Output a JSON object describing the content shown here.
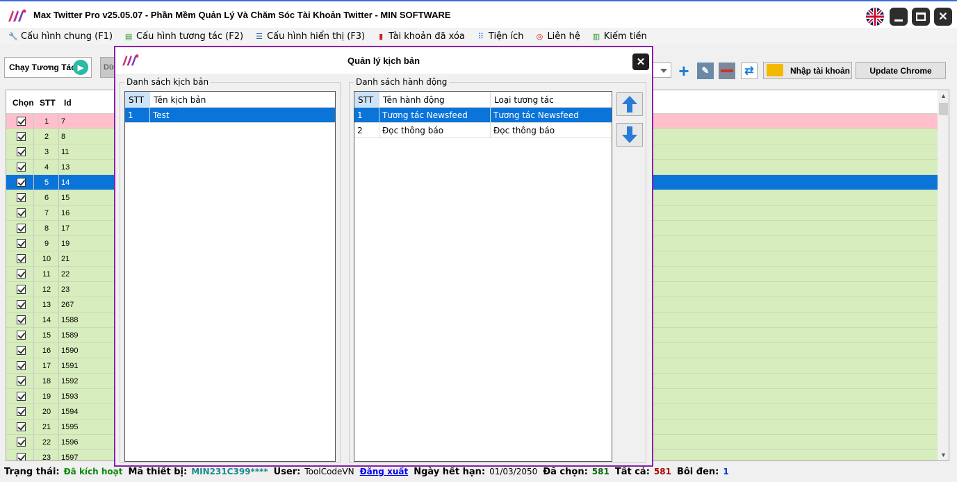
{
  "window": {
    "title": "Max Twitter Pro v25.05.07 - Phần Mềm Quản Lý Và Chăm Sóc Tài Khoản Twitter - MIN SOFTWARE",
    "language_icon": "uk-flag-icon"
  },
  "menu": {
    "items": [
      {
        "label": "Cấu hình chung (F1)",
        "icon": "wrench-icon"
      },
      {
        "label": "Cấu hình tương tác (F2)",
        "icon": "chat-icon"
      },
      {
        "label": "Cấu hình hiển thị (F3)",
        "icon": "list-icon"
      },
      {
        "label": "Tài khoản đã xóa",
        "icon": "trash-icon"
      },
      {
        "label": "Tiện ích",
        "icon": "grid-icon"
      },
      {
        "label": "Liên hệ",
        "icon": "support-icon"
      },
      {
        "label": "Kiếm tiền",
        "icon": "money-icon"
      }
    ]
  },
  "toolbar": {
    "run_label": "Chạy Tương Tác",
    "stop_label": "Dừ",
    "import_label": "Nhập tài khoản",
    "update_label": "Update Chrome"
  },
  "grid": {
    "headers": {
      "chon": "Chọn",
      "stt": "STT",
      "id": "Id"
    },
    "rows": [
      {
        "stt": "1",
        "id": "7",
        "state": "pink"
      },
      {
        "stt": "2",
        "id": "8",
        "state": "green"
      },
      {
        "stt": "3",
        "id": "11",
        "state": "green"
      },
      {
        "stt": "4",
        "id": "13",
        "state": "green"
      },
      {
        "stt": "5",
        "id": "14",
        "state": "sel"
      },
      {
        "stt": "6",
        "id": "15",
        "state": "green"
      },
      {
        "stt": "7",
        "id": "16",
        "state": "green"
      },
      {
        "stt": "8",
        "id": "17",
        "state": "green"
      },
      {
        "stt": "9",
        "id": "19",
        "state": "green"
      },
      {
        "stt": "10",
        "id": "21",
        "state": "green"
      },
      {
        "stt": "11",
        "id": "22",
        "state": "green"
      },
      {
        "stt": "12",
        "id": "23",
        "state": "green"
      },
      {
        "stt": "13",
        "id": "267",
        "state": "green"
      },
      {
        "stt": "14",
        "id": "1588",
        "state": "green"
      },
      {
        "stt": "15",
        "id": "1589",
        "state": "green"
      },
      {
        "stt": "16",
        "id": "1590",
        "state": "green"
      },
      {
        "stt": "17",
        "id": "1591",
        "state": "green"
      },
      {
        "stt": "18",
        "id": "1592",
        "state": "green"
      },
      {
        "stt": "19",
        "id": "1593",
        "state": "green"
      },
      {
        "stt": "20",
        "id": "1594",
        "state": "green"
      },
      {
        "stt": "21",
        "id": "1595",
        "state": "green"
      },
      {
        "stt": "22",
        "id": "1596",
        "state": "green"
      },
      {
        "stt": "23",
        "id": "1597",
        "state": "green"
      }
    ]
  },
  "status": {
    "trang_thai_label": "Trạng thái:",
    "trang_thai_value": "Đã kích hoạt",
    "ma_thiet_bi_label": "Mã thiết bị:",
    "ma_thiet_bi_value": "MIN231C399****",
    "user_label": "User:",
    "user_value": "ToolCodeVN",
    "logout_label": "Đăng xuất",
    "expiry_label": "Ngày hết hạn:",
    "expiry_value": "01/03/2050",
    "selected_label": "Đã chọn:",
    "selected_value": "581",
    "total_label": "Tất cả:",
    "total_value": "581",
    "highlighted_label": "Bôi đen:",
    "highlighted_value": "1",
    "colors": {
      "active": "#0a8a0a",
      "device": "#1a8a8a",
      "selected": "#0a6a0a",
      "total": "#b00000",
      "highlighted": "#0033cc"
    }
  },
  "dialog": {
    "title": "Quản lý kịch bản",
    "scripts_group": "Danh sách kịch bản",
    "scripts_headers": {
      "stt": "STT",
      "name": "Tên kịch bản"
    },
    "scripts": [
      {
        "stt": "1",
        "name": "Test"
      }
    ],
    "actions_group": "Danh sách hành động",
    "actions_headers": {
      "stt": "STT",
      "name": "Tên hành động",
      "type": "Loại tương tác"
    },
    "actions": [
      {
        "stt": "1",
        "name": "Tương tác Newsfeed",
        "type": "Tương tác Newsfeed"
      },
      {
        "stt": "2",
        "name": "Đọc thông báo",
        "type": "Đọc thông báo"
      }
    ]
  }
}
